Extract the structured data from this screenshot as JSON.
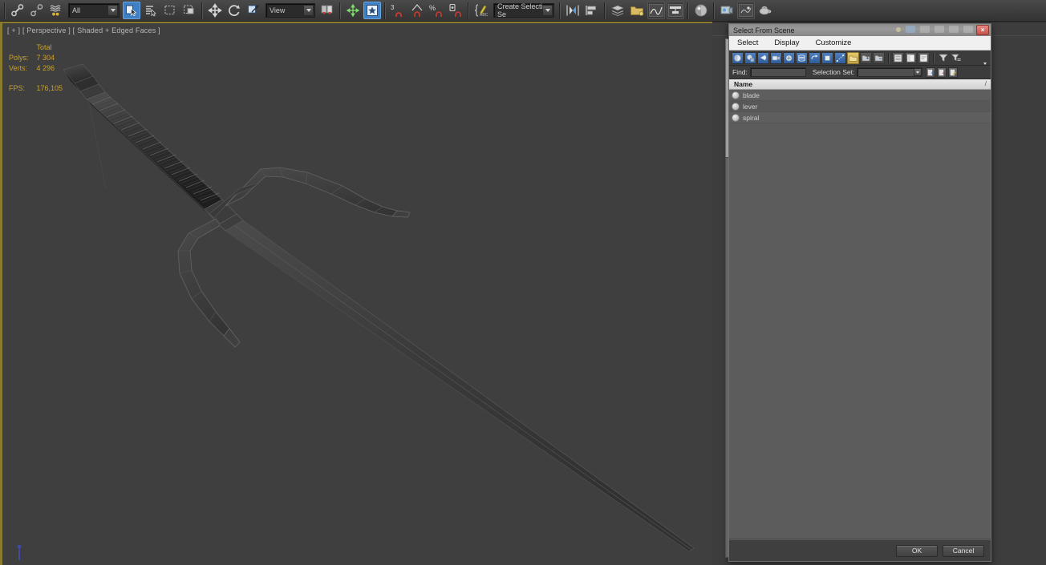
{
  "app": {
    "background_color": "#3d3d3d"
  },
  "main_toolbar": {
    "items": [
      {
        "name": "select-and-link-icon",
        "type": "icon"
      },
      {
        "name": "unlink-selection-icon",
        "type": "icon"
      },
      {
        "name": "bind-to-space-warp-icon",
        "type": "icon"
      },
      {
        "name": "selection-filter-combo",
        "type": "combo",
        "value": "All"
      },
      {
        "name": "select-object-icon",
        "type": "icon",
        "active": true
      },
      {
        "name": "select-by-name-icon",
        "type": "icon"
      },
      {
        "name": "rectangular-selection-region-icon",
        "type": "icon"
      },
      {
        "name": "window-crossing-icon",
        "type": "icon"
      },
      {
        "name": "select-and-move-icon",
        "type": "icon"
      },
      {
        "name": "select-and-rotate-icon",
        "type": "icon"
      },
      {
        "name": "select-and-scale-icon",
        "type": "icon"
      },
      {
        "name": "reference-coordinate-system-combo",
        "type": "combo",
        "value": "View"
      },
      {
        "name": "use-pivot-point-center-icon",
        "type": "icon"
      },
      {
        "name": "select-and-manipulate-icon",
        "type": "icon"
      },
      {
        "name": "snaps-toggle-icon",
        "type": "icon",
        "active": true
      },
      {
        "name": "snap-3d-icon",
        "type": "icon",
        "label": "3"
      },
      {
        "name": "angle-snap-toggle-icon",
        "type": "icon"
      },
      {
        "name": "percent-snap-toggle-icon",
        "type": "icon",
        "label": "%"
      },
      {
        "name": "spinner-snap-toggle-icon",
        "type": "icon"
      },
      {
        "name": "edit-named-selection-sets-icon",
        "type": "icon"
      },
      {
        "name": "named-selection-set-combo",
        "type": "combo",
        "value": "Create Selection Se"
      },
      {
        "name": "mirror-icon",
        "type": "icon"
      },
      {
        "name": "align-icon",
        "type": "icon"
      },
      {
        "name": "layer-manager-icon",
        "type": "icon"
      },
      {
        "name": "open-explorer-icon",
        "type": "icon"
      },
      {
        "name": "curve-editor-icon",
        "type": "icon"
      },
      {
        "name": "schematic-view-icon",
        "type": "icon"
      },
      {
        "name": "material-editor-icon",
        "type": "icon"
      },
      {
        "name": "render-setup-icon",
        "type": "icon"
      },
      {
        "name": "rendered-frame-window-icon",
        "type": "icon"
      },
      {
        "name": "render-production-icon",
        "type": "icon"
      }
    ],
    "filter_value": "All",
    "coordsys_value": "View",
    "selection_set_value": "Create Selection Se",
    "snap3d_label": "3",
    "percent_label": "%"
  },
  "viewport": {
    "label": "[ + ] [ Perspective ] [ Shaded + Edged Faces ]",
    "stats": {
      "header": "Total",
      "rows": [
        {
          "label": "Polys:",
          "value": "7 304"
        },
        {
          "label": "Verts:",
          "value": "4 296"
        }
      ],
      "fps_label": "FPS:",
      "fps_value": "176,105"
    },
    "border_color": "#8a7b2e",
    "bg_color": "#3f3f3f",
    "model_description": "wireframe sword with wrapped grip, crossguard and long tapered blade"
  },
  "dialog": {
    "title": "Select From Scene",
    "close_glyph": "×",
    "menu": [
      {
        "label": "Select"
      },
      {
        "label": "Display"
      },
      {
        "label": "Customize"
      }
    ],
    "toolbar": [
      {
        "name": "display-geometry-icon",
        "style": "blue"
      },
      {
        "name": "display-shapes-icon",
        "style": "blue"
      },
      {
        "name": "display-lights-icon",
        "style": "blue"
      },
      {
        "name": "display-cameras-icon",
        "style": "blue"
      },
      {
        "name": "display-helpers-icon",
        "style": "blue"
      },
      {
        "name": "display-space-warps-icon",
        "style": "blue"
      },
      {
        "name": "display-groups-icon",
        "style": "blue"
      },
      {
        "name": "display-xrefs-icon",
        "style": "blue"
      },
      {
        "name": "display-bone-objects-icon",
        "style": "blue"
      },
      {
        "name": "display-containers-icon",
        "style": "blue"
      },
      {
        "name": "display-children-icon",
        "style": "grey"
      },
      {
        "name": "display-influences-icon",
        "style": "grey"
      },
      {
        "name": "expand-all-icon",
        "style": "grey"
      },
      {
        "name": "collapse-all-icon",
        "style": "grey"
      },
      {
        "name": "select-subtree-icon",
        "style": "grey"
      },
      {
        "name": "filter-icon",
        "style": "plain"
      },
      {
        "name": "advanced-filter-icon",
        "style": "plain"
      }
    ],
    "find": {
      "label": "Find:",
      "value": "",
      "placeholder": ""
    },
    "selection_set": {
      "label": "Selection Set:",
      "value": "",
      "placeholder": "",
      "buttons": [
        {
          "name": "add-selection-set-icon"
        },
        {
          "name": "remove-selection-set-icon"
        },
        {
          "name": "edit-selection-set-icon"
        }
      ]
    },
    "list": {
      "column_header": "Name",
      "sort_mark": "/",
      "rows": [
        {
          "label": "blade",
          "icon": "sphere-object-icon"
        },
        {
          "label": "lever",
          "icon": "sphere-object-icon"
        },
        {
          "label": "spiral",
          "icon": "sphere-object-icon"
        }
      ]
    },
    "footer": {
      "ok_label": "OK",
      "cancel_label": "Cancel"
    }
  }
}
